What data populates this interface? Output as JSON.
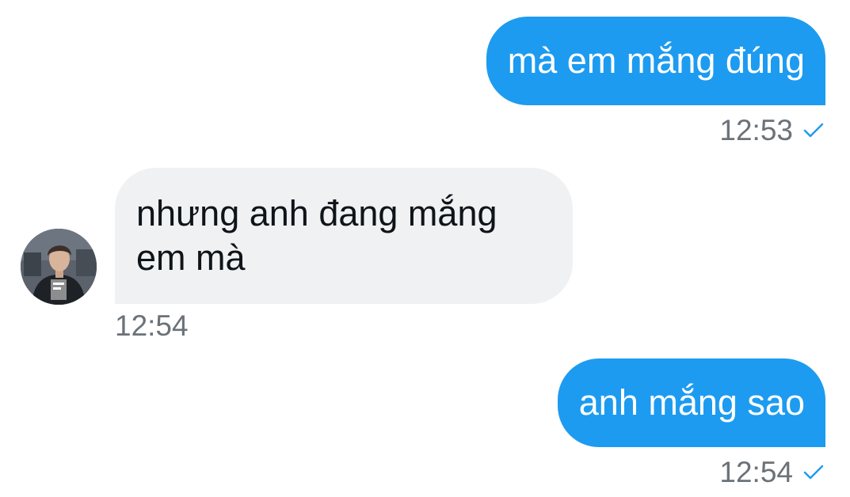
{
  "conversation": {
    "messages": [
      {
        "direction": "outgoing",
        "text": "mà em mắng đúng",
        "time": "12:53",
        "status_icon": "check-icon"
      },
      {
        "direction": "incoming",
        "text": "nhưng anh đang mắng em mà",
        "time": "12:54",
        "avatar": "contact-avatar"
      },
      {
        "direction": "outgoing",
        "text": "anh mắng sao",
        "time": "12:54",
        "status_icon": "check-icon"
      }
    ]
  },
  "colors": {
    "outgoing_bubble": "#1d9bf0",
    "incoming_bubble": "#eff1f3",
    "timestamp": "#6b7278",
    "check": "#1d9bf0"
  }
}
